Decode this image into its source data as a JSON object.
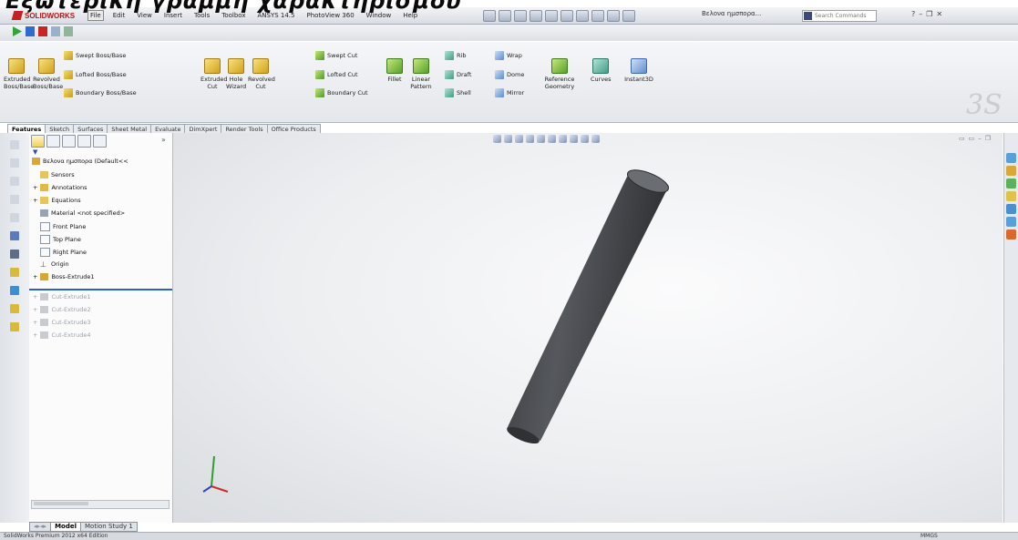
{
  "caption": "Εξωτερική γραμμή χαρακτηρισμού",
  "app": {
    "logo_text": "SOLIDWORKS",
    "menu": [
      "File",
      "Edit",
      "View",
      "Insert",
      "Tools",
      "Toolbox",
      "ANSYS 14.5",
      "PhotoView 360",
      "Window",
      "Help"
    ],
    "document_title": "Βελονα ημσπορα...",
    "search_placeholder": "Search Commands"
  },
  "command_manager": {
    "extruded_boss": "Extruded Boss/Base",
    "revolved_boss": "Revolved Boss/Base",
    "swept_boss": "Swept Boss/Base",
    "lofted_boss": "Lofted Boss/Base",
    "boundary_boss": "Boundary Boss/Base",
    "extruded_cut": "Extruded Cut",
    "hole_wizard": "Hole Wizard",
    "revolved_cut": "Revolved Cut",
    "swept_cut": "Swept Cut",
    "lofted_cut": "Lofted Cut",
    "boundary_cut": "Boundary Cut",
    "fillet": "Fillet",
    "linear_pattern": "Linear Pattern",
    "rib": "Rib",
    "draft": "Draft",
    "shell": "Shell",
    "wrap": "Wrap",
    "dome": "Dome",
    "mirror": "Mirror",
    "reference_geometry": "Reference Geometry",
    "curves": "Curves",
    "instant3d": "Instant3D"
  },
  "cm_tabs": [
    "Features",
    "Sketch",
    "Surfaces",
    "Sheet Metal",
    "Evaluate",
    "DimXpert",
    "Render Tools",
    "Office Products"
  ],
  "feature_tree": {
    "part_name": "Βελονα ημσπορα (Default<<",
    "items": [
      {
        "label": "Sensors",
        "dim": false
      },
      {
        "label": "Annotations",
        "dim": false
      },
      {
        "label": "Equations",
        "dim": false
      },
      {
        "label": "Material <not specified>",
        "dim": false
      },
      {
        "label": "Front Plane",
        "dim": false
      },
      {
        "label": "Top Plane",
        "dim": false
      },
      {
        "label": "Right Plane",
        "dim": false
      },
      {
        "label": "Origin",
        "dim": false
      },
      {
        "label": "Boss-Extrude1",
        "dim": false
      },
      {
        "label": "Cut-Extrude1",
        "dim": true
      },
      {
        "label": "Cut-Extrude2",
        "dim": true
      },
      {
        "label": "Cut-Extrude3",
        "dim": true
      },
      {
        "label": "Cut-Extrude4",
        "dim": true
      }
    ]
  },
  "bottom_tabs": [
    "Model",
    "Motion Study 1"
  ],
  "status": {
    "left": "SolidWorks Premium 2012 x64 Edition",
    "units": "MMGS"
  },
  "colors": {
    "rollback_bar": "#2a63c8",
    "cylinder": "#4a4c50"
  }
}
